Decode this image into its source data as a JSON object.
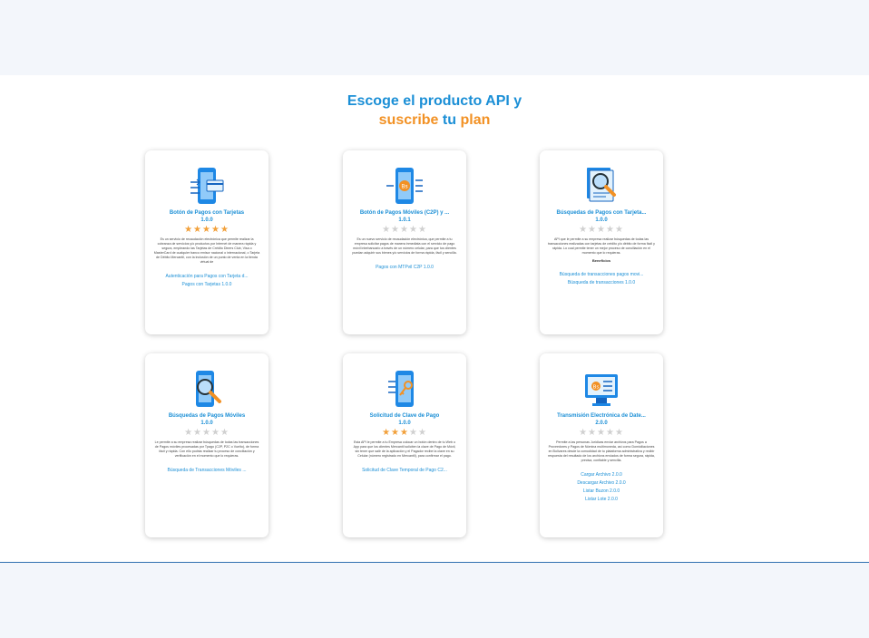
{
  "heading": {
    "line1": "Escoge el producto API y",
    "suscribe": "suscribe",
    "tu": "tu",
    "plan": "plan"
  },
  "colors": {
    "blue": "#1b8fd6",
    "orange": "#f29124"
  },
  "cards": [
    {
      "icon": "phone-card-icon",
      "title": "Botón de Pagos con Tarjetas",
      "version": "1.0.0",
      "rating": 5,
      "description": "Es un servicio de recaudación electrónica que permite realizar la cobranza de servicios y/o productos por Internet de manera rápida y segura, empleando las Tarjetas de Crédito Diners Club, Visa o MasterCard de cualquier banco emisor nacional o internacional, o Tarjeta de Débito Mercantil, con la inclusión de un punto de venta en la tienda virtual de",
      "benefits": "",
      "links": [
        "Autenticación para Pagos con Tarjeta d...",
        "Pagos con Tarjetas    1.0.0"
      ]
    },
    {
      "icon": "phone-mobile-payment-icon",
      "title": "Botón de Pagos Móviles (C2P) y ...",
      "version": "1.0.1",
      "rating": 0,
      "description": "Es un nuevo servicio de recaudación electrónica, que permite a tu empresa solicitar pagos de manera inmediata con el servicio de pago móvil interbancario a través de un número celular, para que tus clientes puedan adquirir sus bienes y/o servicios de forma rápida, fácil y sencilla.",
      "benefits": "",
      "links": [
        "Pagos con MTPvil C2P    1.0.0"
      ]
    },
    {
      "icon": "document-search-icon",
      "title": "Búsquedas de Pagos con Tarjeta...",
      "version": "1.0.0",
      "rating": 0,
      "description": "API que le permite a su empresa realizar búsquedas de todas las transacciones realizadas con tarjetas de crédito y/o débito de forma fácil y rápida. Lo cual permite tener un mejor proceso de conciliación en el momento que lo requieras.",
      "benefits": "Beneficios",
      "links": [
        "Búsqueda de transacciones pagos movi...",
        "Búsqueda de transacciones    1.0.0"
      ]
    },
    {
      "icon": "phone-search-icon",
      "title": "Búsquedas de Pagos Móviles",
      "version": "1.0.0",
      "rating": 0,
      "description": "Le permite a su empresa realizar búsquedas de todas las transacciones de Pagos móviles procesadas por Tpago (C2P, P2C o Vuelto), de forma fácil y rápida. Con ello podrás realizar tu proceso de conciliación y verificación en el momento que lo requieras.",
      "benefits": "",
      "links": [
        "Búsqueda de Transacciones Móviles ..."
      ]
    },
    {
      "icon": "phone-key-icon",
      "title": "Solicitud de Clave de Pago",
      "version": "1.0.0",
      "rating": 3,
      "description": "Esta API le permite a tu Empresa colocar un botón dentro de tu Web o App para que los clientes Mercantil soliciten la clave de Pago de Móvil, sin tener que salir de la aplicación y el Pagador recibe la clave en su Celular (número registrado en Mercantil), para confirmar el pago.",
      "benefits": "",
      "links": [
        "Solicitud de Clave Temporal de Pago C2..."
      ]
    },
    {
      "icon": "monitor-transfer-icon",
      "title": "Transmisión Electrónica de Date...",
      "version": "2.0.0",
      "rating": 0,
      "description": "Permite a las personas Jurídicas enviar archivos para Pagos a Proveedores y Pagos de Nómina multimoneda, así como Domiciliaciones en Bolívares desde la comodidad de tu plataforma administrativa y recibir respuesta del resultado de los archivos enviados de forma segura, rápida, precisa, confiable y sencilla.",
      "benefits": "",
      "links": [
        "Cargar Archivo    2.0.0",
        "Descargar Archivo    2.0.0",
        "Listar Buzon    2.0.0",
        "Listar Lote    2.0.0"
      ]
    }
  ]
}
